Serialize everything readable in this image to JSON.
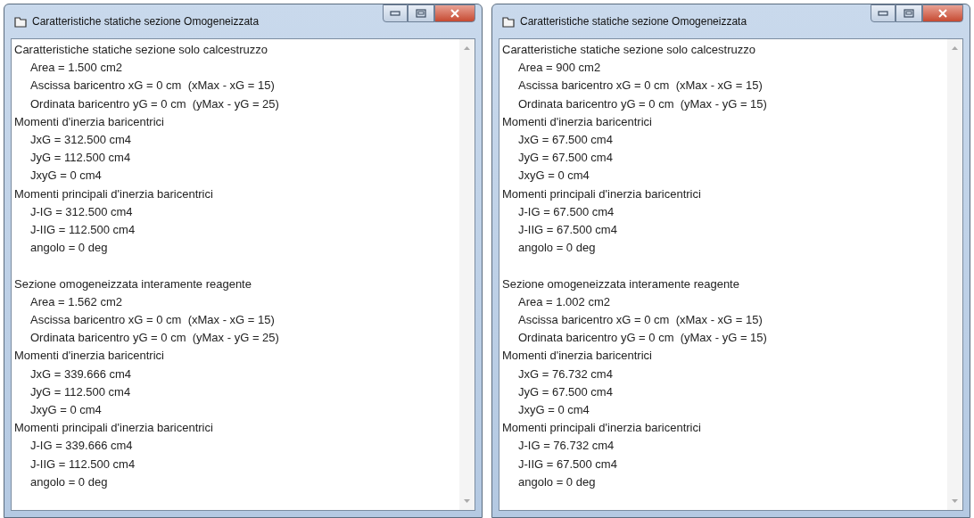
{
  "windows": [
    {
      "title": "Caratteristiche statiche sezione Omogeneizzata",
      "lines": [
        {
          "kind": "heading",
          "text": "Caratteristiche statiche sezione solo calcestruzzo"
        },
        {
          "kind": "item",
          "text": "Area = 1.500 cm2"
        },
        {
          "kind": "item",
          "text": "Ascissa baricentro xG = 0 cm  (xMax - xG = 15)"
        },
        {
          "kind": "item",
          "text": "Ordinata baricentro yG = 0 cm  (yMax - yG = 25)"
        },
        {
          "kind": "heading",
          "text": "Momenti d'inerzia baricentrici"
        },
        {
          "kind": "item",
          "text": "JxG = 312.500 cm4"
        },
        {
          "kind": "item",
          "text": "JyG = 112.500 cm4"
        },
        {
          "kind": "item",
          "text": "JxyG = 0 cm4"
        },
        {
          "kind": "heading",
          "text": "Momenti principali d'inerzia baricentrici"
        },
        {
          "kind": "item",
          "text": "J-IG = 312.500 cm4"
        },
        {
          "kind": "item",
          "text": "J-IIG = 112.500 cm4"
        },
        {
          "kind": "item",
          "text": "angolo = 0 deg"
        },
        {
          "kind": "blank"
        },
        {
          "kind": "heading",
          "text": "Sezione omogeneizzata interamente reagente"
        },
        {
          "kind": "item",
          "text": "Area = 1.562 cm2"
        },
        {
          "kind": "item",
          "text": "Ascissa baricentro xG = 0 cm  (xMax - xG = 15)"
        },
        {
          "kind": "item",
          "text": "Ordinata baricentro yG = 0 cm  (yMax - yG = 25)"
        },
        {
          "kind": "heading",
          "text": "Momenti d'inerzia baricentrici"
        },
        {
          "kind": "item",
          "text": "JxG = 339.666 cm4"
        },
        {
          "kind": "item",
          "text": "JyG = 112.500 cm4"
        },
        {
          "kind": "item",
          "text": "JxyG = 0 cm4"
        },
        {
          "kind": "heading",
          "text": "Momenti principali d'inerzia baricentrici"
        },
        {
          "kind": "item",
          "text": "J-IG = 339.666 cm4"
        },
        {
          "kind": "item",
          "text": "J-IIG = 112.500 cm4"
        },
        {
          "kind": "item",
          "text": "angolo = 0 deg"
        }
      ]
    },
    {
      "title": "Caratteristiche statiche sezione Omogeneizzata",
      "lines": [
        {
          "kind": "heading",
          "text": "Caratteristiche statiche sezione solo calcestruzzo"
        },
        {
          "kind": "item",
          "text": "Area = 900 cm2"
        },
        {
          "kind": "item",
          "text": "Ascissa baricentro xG = 0 cm  (xMax - xG = 15)"
        },
        {
          "kind": "item",
          "text": "Ordinata baricentro yG = 0 cm  (yMax - yG = 15)"
        },
        {
          "kind": "heading",
          "text": "Momenti d'inerzia baricentrici"
        },
        {
          "kind": "item",
          "text": "JxG = 67.500 cm4"
        },
        {
          "kind": "item",
          "text": "JyG = 67.500 cm4"
        },
        {
          "kind": "item",
          "text": "JxyG = 0 cm4"
        },
        {
          "kind": "heading",
          "text": "Momenti principali d'inerzia baricentrici"
        },
        {
          "kind": "item",
          "text": "J-IG = 67.500 cm4"
        },
        {
          "kind": "item",
          "text": "J-IIG = 67.500 cm4"
        },
        {
          "kind": "item",
          "text": "angolo = 0 deg"
        },
        {
          "kind": "blank"
        },
        {
          "kind": "heading",
          "text": "Sezione omogeneizzata interamente reagente"
        },
        {
          "kind": "item",
          "text": "Area = 1.002 cm2"
        },
        {
          "kind": "item",
          "text": "Ascissa baricentro xG = 0 cm  (xMax - xG = 15)"
        },
        {
          "kind": "item",
          "text": "Ordinata baricentro yG = 0 cm  (yMax - yG = 15)"
        },
        {
          "kind": "heading",
          "text": "Momenti d'inerzia baricentrici"
        },
        {
          "kind": "item",
          "text": "JxG = 76.732 cm4"
        },
        {
          "kind": "item",
          "text": "JyG = 67.500 cm4"
        },
        {
          "kind": "item",
          "text": "JxyG = 0 cm4"
        },
        {
          "kind": "heading",
          "text": "Momenti principali d'inerzia baricentrici"
        },
        {
          "kind": "item",
          "text": "J-IG = 76.732 cm4"
        },
        {
          "kind": "item",
          "text": "J-IIG = 67.500 cm4"
        },
        {
          "kind": "item",
          "text": "angolo = 0 deg"
        }
      ]
    }
  ]
}
